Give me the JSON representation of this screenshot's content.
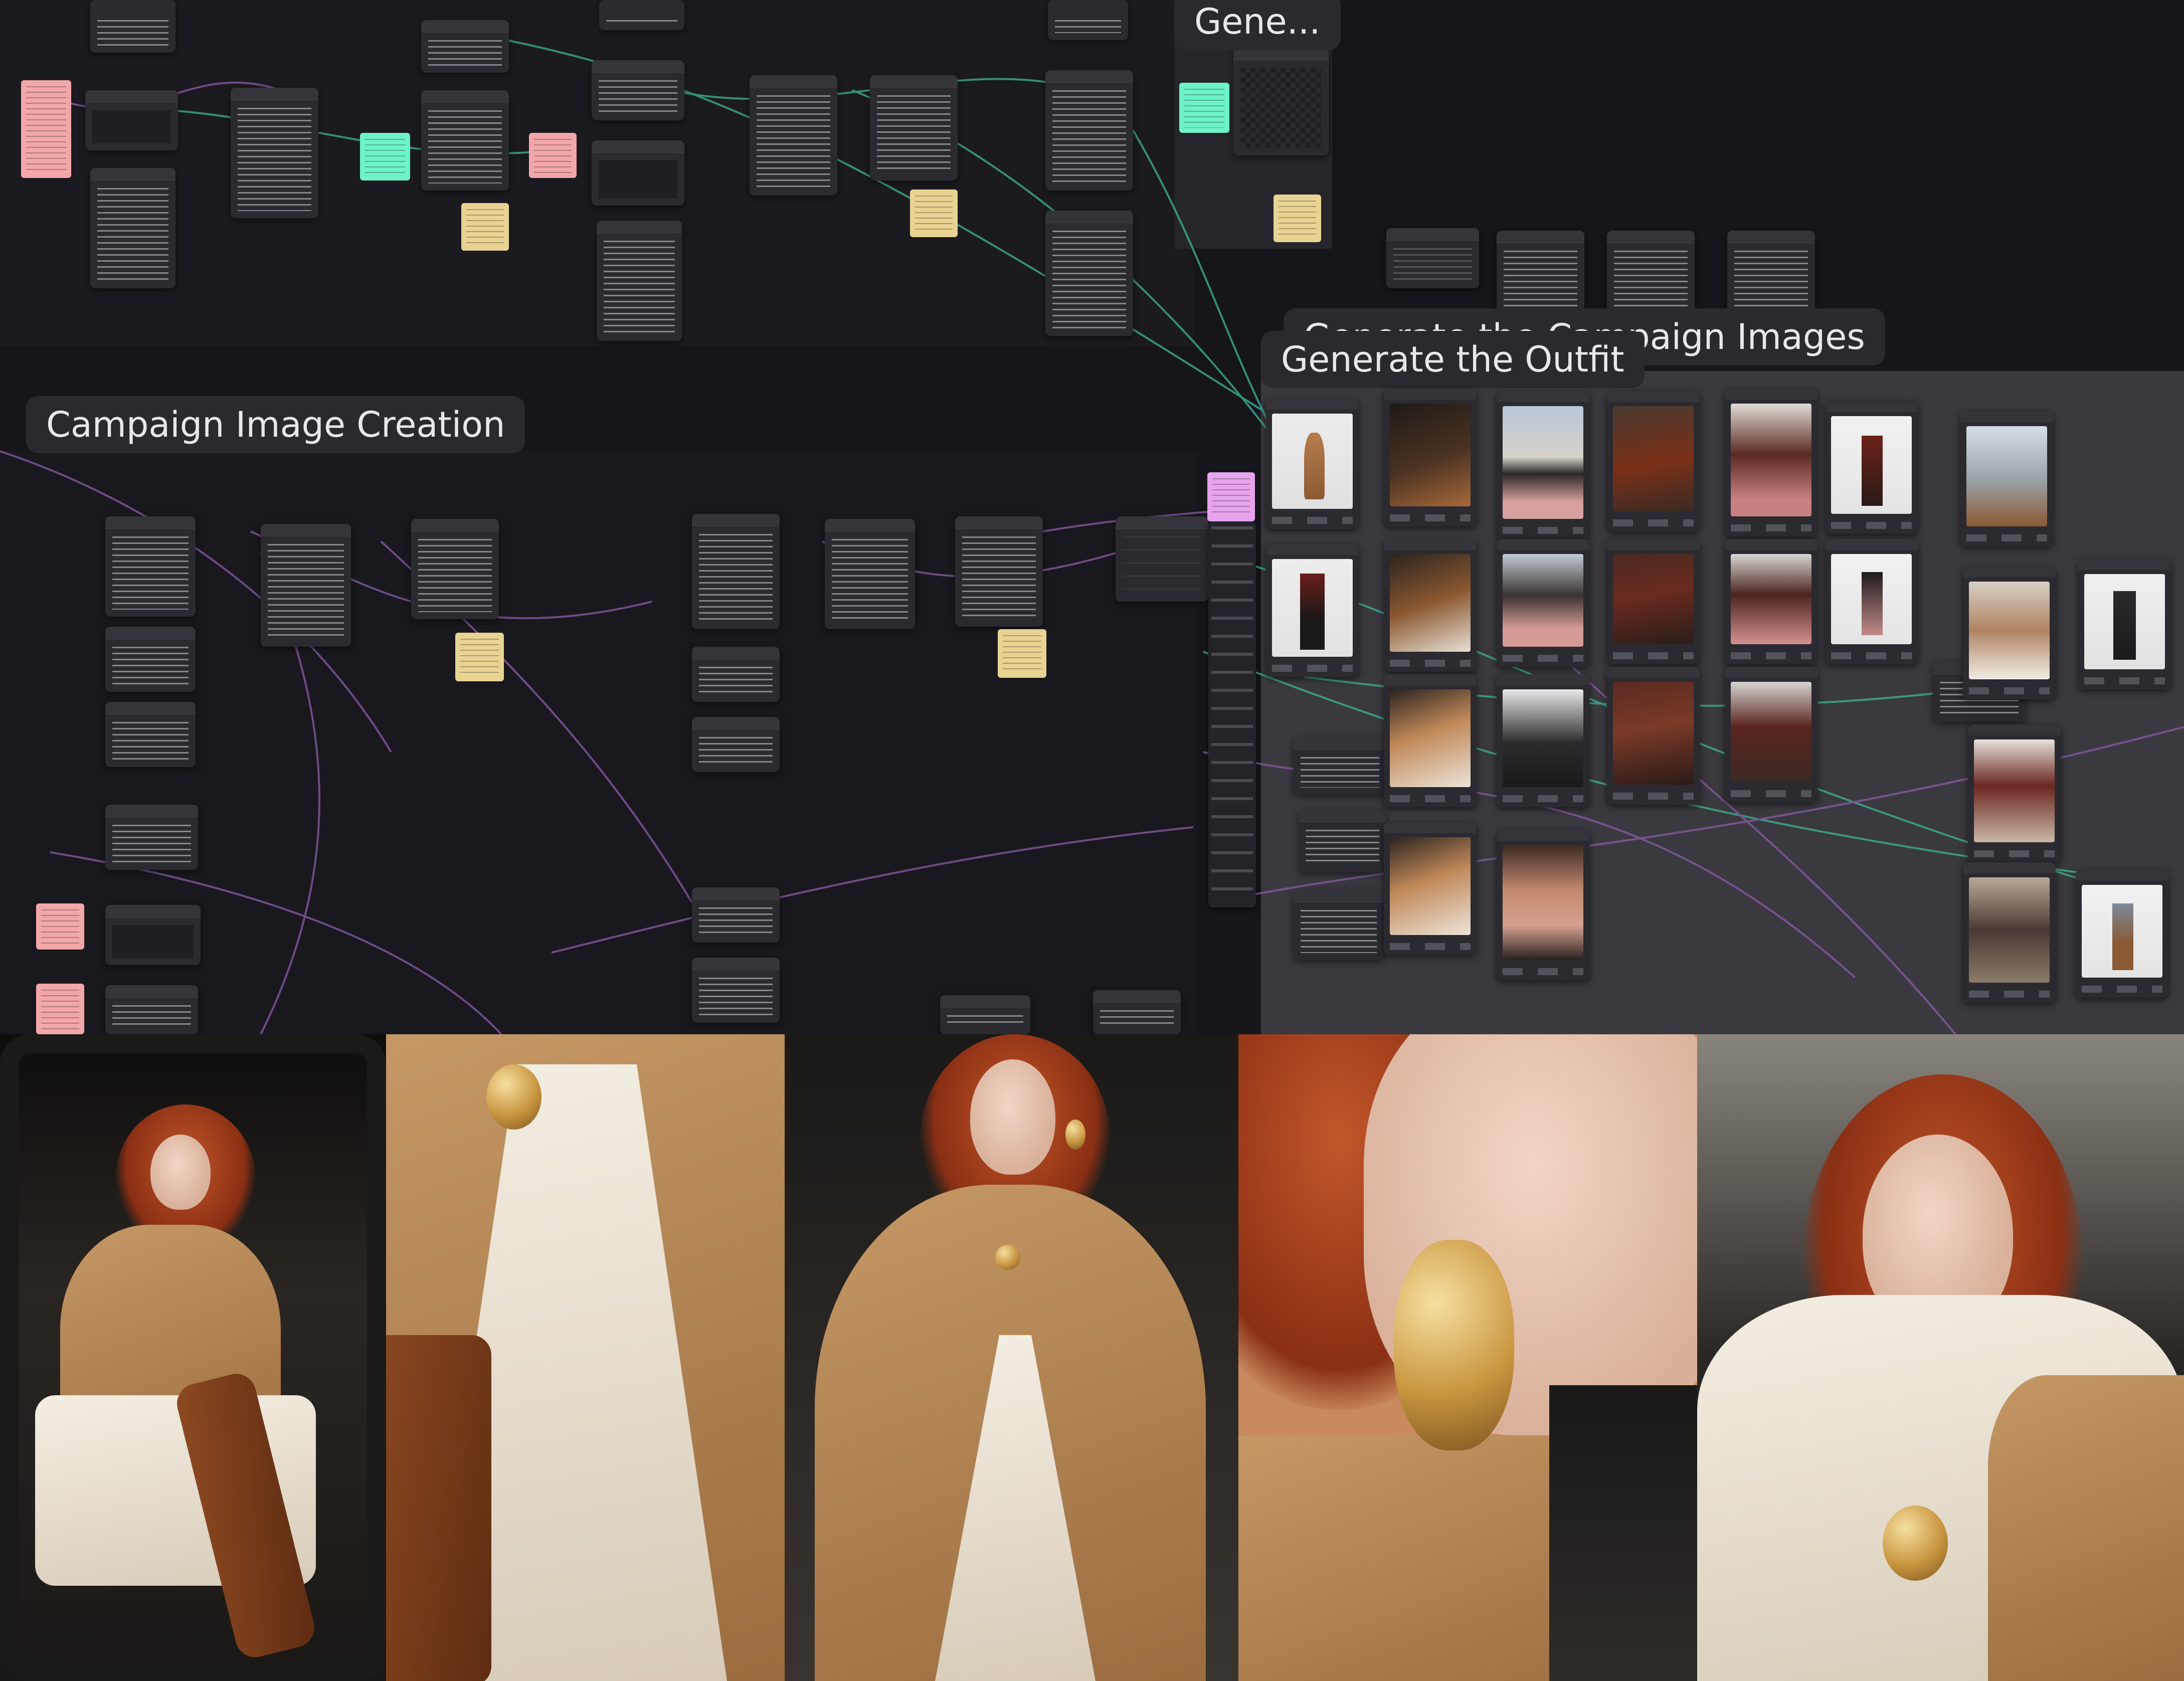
{
  "groups": {
    "top_right": "Gene...",
    "campaign_overlay": "Generate the Campaign Images",
    "outfit": "Generate the Outfit",
    "campaign_image_creation": "Campaign Image Creation"
  },
  "colors": {
    "canvas": "#16151b",
    "group": "#1e1d23",
    "node": "#2b2a31",
    "note_pink": "#f2a7a9",
    "note_yellow": "#e8d393",
    "note_teal": "#6df2c9",
    "note_violet": "#e6a4ee",
    "wire_teal": "#3fb597",
    "wire_violet": "#8b5ca6"
  },
  "icons": {
    "node_port": "port-dot-icon",
    "node_output": "output-port-icon"
  },
  "photos": {
    "count": 5,
    "subjects": [
      "model-in-car",
      "coat-detail",
      "model-portrait",
      "earring-closeup",
      "model-hand-on-head"
    ]
  }
}
